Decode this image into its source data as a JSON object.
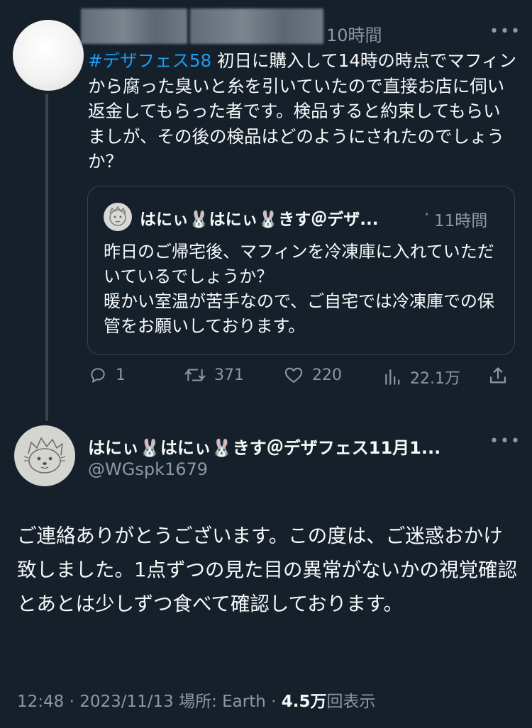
{
  "reply_tweet": {
    "time": "10時間",
    "hashtag": "#デザフェス58",
    "text": " 初日に購入して14時の時点でマフィンから腐った臭いと糸を引いていたので直接お店に伺い返金してもらった者です。検品すると約束してもらいましが、その後の検品はどのようにされたのでしょうか？",
    "quote": {
      "author": "はにぃ🐰はにぃ🐰きす＠デザ...",
      "separator": "·",
      "time": "11時間",
      "text": "昨日のご帰宅後、マフィンを冷凍庫に入れていただいているでしょうか？\n暖かい室温が苦手なので、ご自宅では冷凍庫での保管をお願いしております。"
    },
    "actions": {
      "replies": "1",
      "retweets": "371",
      "likes": "220",
      "views": "22.1万"
    }
  },
  "main_tweet": {
    "author": "はにぃ🐰はにぃ🐰きす＠デザフェス11月1...",
    "handle": "@WGspk1679",
    "text": "ご連絡ありがとうございます。この度は、ご迷惑おかけ致しました。1点ずつの見た目の異常がないかの視覚確認とあとは少しずつ食べて確認しております。",
    "meta": {
      "timestamp": "12:48 · 2023/11/13 場所: Earth · ",
      "views_count": "4.5万",
      "views_label": "回表示"
    }
  },
  "more_glyph": "•••",
  "colors": {
    "background": "#15202b",
    "text": "#f7f9f9",
    "muted": "#8b98a5",
    "link": "#1d9bf0",
    "border": "#38444d"
  },
  "icons": [
    "reply-icon",
    "retweet-icon",
    "like-icon",
    "views-icon",
    "share-icon",
    "more-icon"
  ]
}
